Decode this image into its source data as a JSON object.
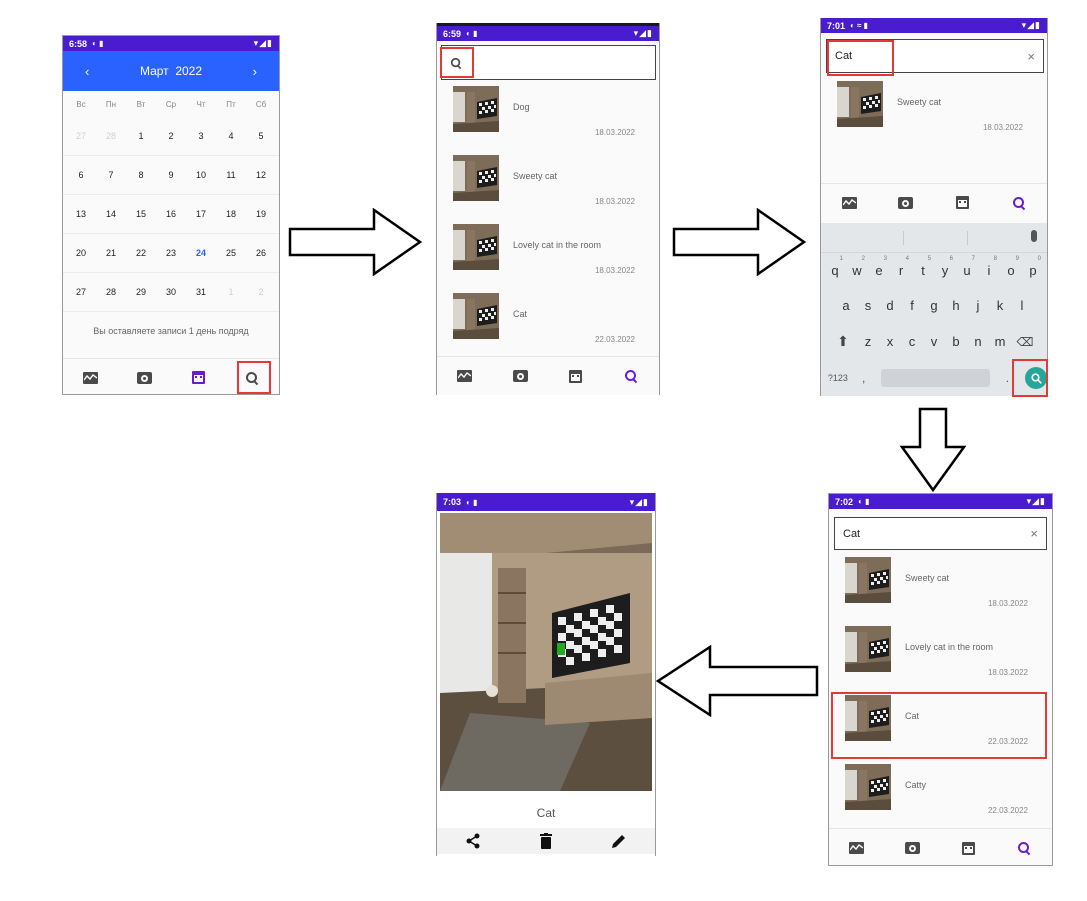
{
  "screens": {
    "calendar": {
      "status_time": "6:58",
      "month_title": "Март  2022",
      "prev": "‹",
      "next": "›",
      "weekdays": [
        "Вс",
        "Пн",
        "Вт",
        "Ср",
        "Чт",
        "Пт",
        "Сб"
      ],
      "weeks": [
        [
          "27",
          "28",
          "1",
          "2",
          "3",
          "4",
          "5"
        ],
        [
          "6",
          "7",
          "8",
          "9",
          "10",
          "11",
          "12"
        ],
        [
          "13",
          "14",
          "15",
          "16",
          "17",
          "18",
          "19"
        ],
        [
          "20",
          "21",
          "22",
          "23",
          "24",
          "25",
          "26"
        ],
        [
          "27",
          "28",
          "29",
          "30",
          "31",
          "1",
          "2"
        ]
      ],
      "today": "24",
      "streak_text": "Вы оставляете записи 1 день подряд"
    },
    "list_empty_search": {
      "status_time": "6:59",
      "entries": [
        {
          "title": "Dog",
          "date": "18.03.2022"
        },
        {
          "title": "Sweety cat",
          "date": "18.03.2022"
        },
        {
          "title": "Lovely cat in the room",
          "date": "18.03.2022"
        },
        {
          "title": "Cat",
          "date": "22.03.2022"
        }
      ]
    },
    "typing": {
      "status_time": "7:01",
      "query": "Cat",
      "clear": "×",
      "entries": [
        {
          "title": "Sweety cat",
          "date": "18.03.2022"
        }
      ],
      "keyboard": {
        "row1": [
          "q",
          "w",
          "e",
          "r",
          "t",
          "y",
          "u",
          "i",
          "o",
          "p"
        ],
        "row1_nums": [
          "1",
          "2",
          "3",
          "4",
          "5",
          "6",
          "7",
          "8",
          "9",
          "0"
        ],
        "row2": [
          "a",
          "s",
          "d",
          "f",
          "g",
          "h",
          "j",
          "k",
          "l"
        ],
        "row3": [
          "z",
          "x",
          "c",
          "v",
          "b",
          "n",
          "m"
        ],
        "sym": "?123",
        "comma": ",",
        "period": "."
      }
    },
    "results": {
      "status_time": "7:02",
      "query": "Cat",
      "clear": "×",
      "entries": [
        {
          "title": "Sweety cat",
          "date": "18.03.2022"
        },
        {
          "title": "Lovely cat in the room",
          "date": "18.03.2022"
        },
        {
          "title": "Cat",
          "date": "22.03.2022"
        },
        {
          "title": "Catty",
          "date": "22.03.2022"
        }
      ]
    },
    "detail": {
      "status_time": "7:03",
      "title": "Cat"
    }
  },
  "colors": {
    "status_bar": "#4a1ccf",
    "calendar_header": "#2962ff",
    "accent_purple": "#6a1bd8",
    "highlight_red": "#e53935",
    "keyboard_search": "#26a69a"
  },
  "icons": [
    "chart-icon",
    "camera-icon",
    "calendar-icon",
    "search-icon",
    "share-icon",
    "delete-icon",
    "edit-icon",
    "close-icon",
    "mic-icon",
    "shift-icon",
    "backspace-icon",
    "arrow-right",
    "arrow-down",
    "arrow-left"
  ]
}
